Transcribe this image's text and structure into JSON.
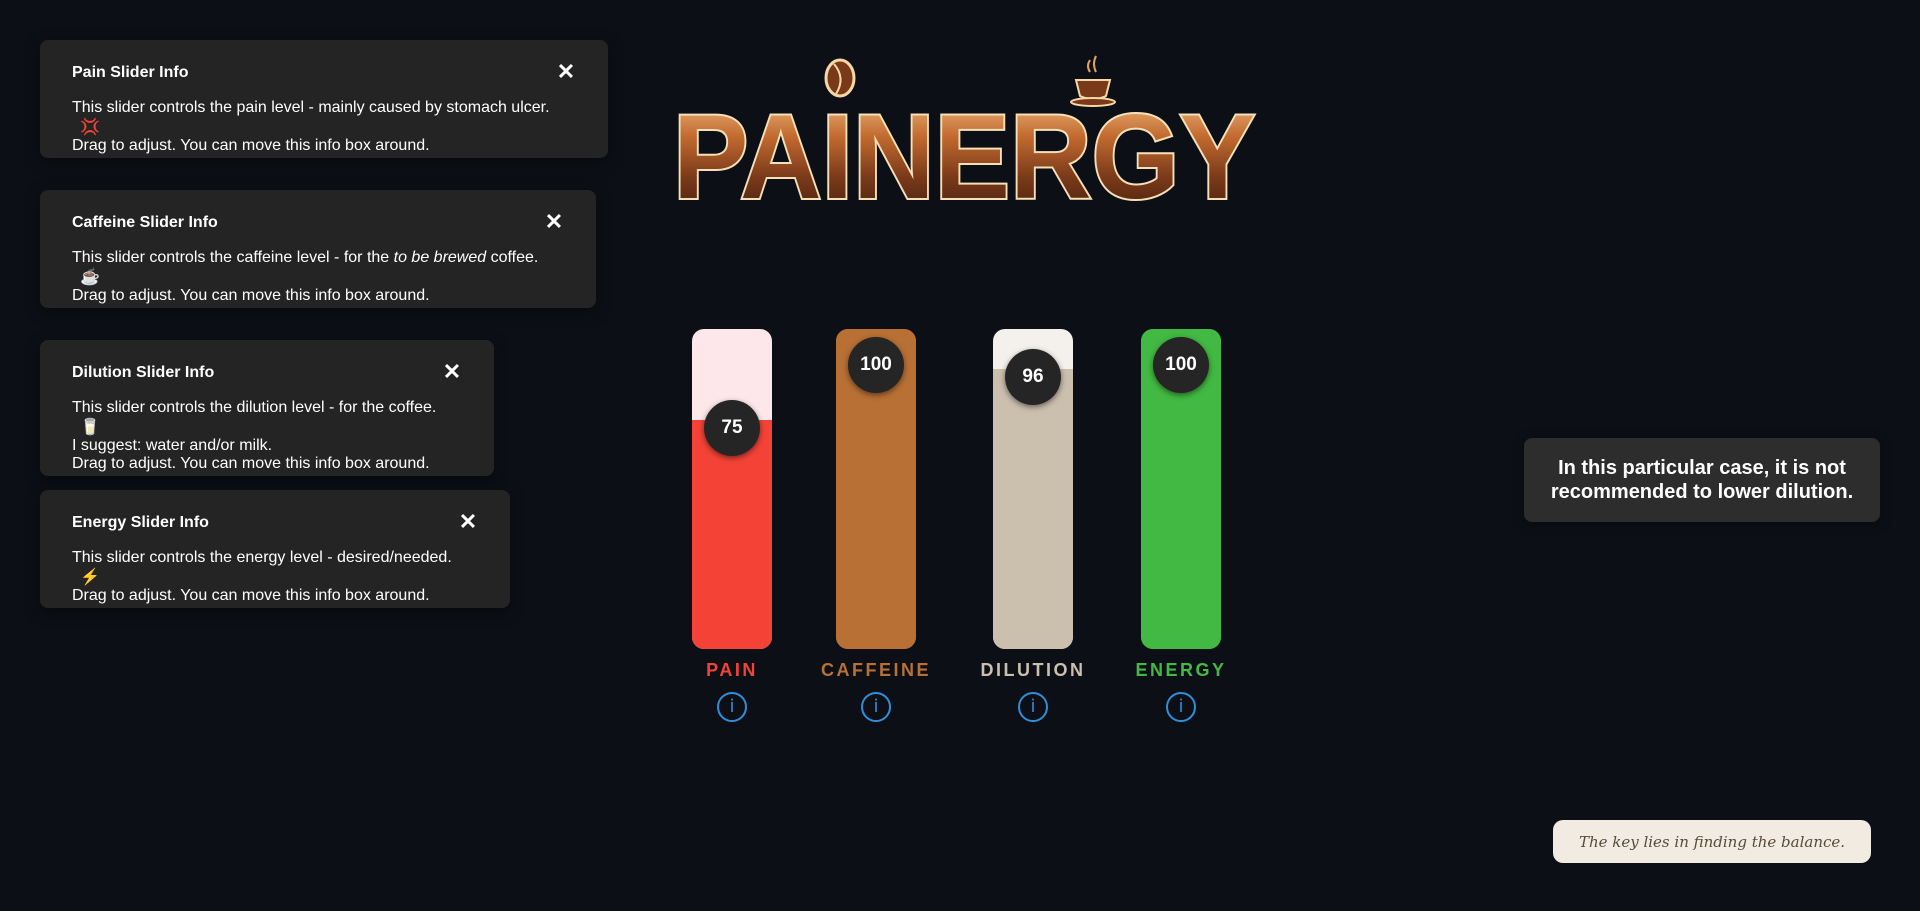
{
  "logo": {
    "text": "PAINERGY"
  },
  "info_boxes": [
    {
      "title": "Pain Slider Info",
      "close": "✕",
      "lines": [
        "This slider controls the pain level - mainly caused by stomach ulcer.",
        "Drag to adjust. You can move this info box around."
      ],
      "emoji": "💢"
    },
    {
      "title": "Caffeine Slider Info",
      "close": "✕",
      "line1_before": "This slider controls the caffeine level - for the ",
      "line1_em": "to be brewed",
      "line1_after": " coffee.",
      "line2": "Drag to adjust. You can move this info box around.",
      "emoji": "☕"
    },
    {
      "title": "Dilution Slider Info",
      "close": "✕",
      "lines": [
        "This slider controls the dilution level - for the coffee.",
        "I suggest: water and/or milk.",
        "Drag to adjust. You can move this info box around."
      ],
      "emoji": "🥛"
    },
    {
      "title": "Energy Slider Info",
      "close": "✕",
      "lines": [
        "This slider controls the energy level - desired/needed.",
        "Drag to adjust. You can move this info box around."
      ],
      "emoji": "⚡"
    }
  ],
  "sliders": [
    {
      "name": "PAIN",
      "value": 75,
      "value_text": "75",
      "color": "#f44336",
      "rest_color": "#fde7ea",
      "info": "i"
    },
    {
      "name": "CAFFEINE",
      "value": 100,
      "value_text": "100",
      "color": "#b87035",
      "rest_color": "#b87035",
      "info": "i"
    },
    {
      "name": "DILUTION",
      "value": 96,
      "value_text": "96",
      "color": "#cbbfae",
      "rest_color": "#f4f1ec",
      "info": "i"
    },
    {
      "name": "ENERGY",
      "value": 100,
      "value_text": "100",
      "color": "#42b942",
      "rest_color": "#42b942",
      "info": "i"
    }
  ],
  "notice": "In this particular case, it is not recommended to lower dilution.",
  "balance_note": "The key lies in finding the balance."
}
